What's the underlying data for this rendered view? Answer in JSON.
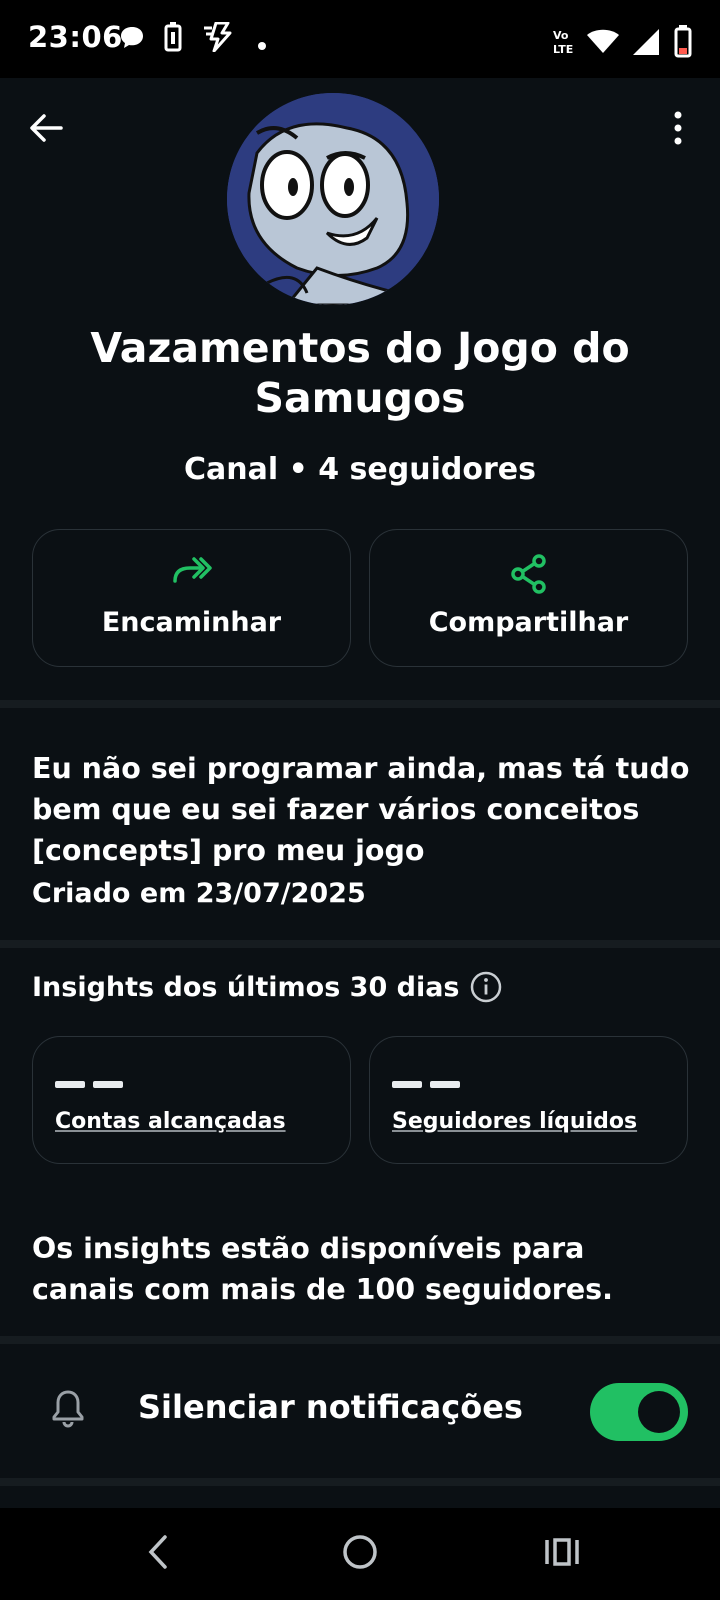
{
  "status_bar": {
    "time": "23:06",
    "left_icons": [
      "chat-bubble-icon",
      "battery-saver-icon",
      "flash-icon",
      "dot-icon"
    ],
    "right_icons": [
      "volte-icon",
      "wifi-icon",
      "signal-icon",
      "battery-icon"
    ],
    "volte_text": "Vo LTE"
  },
  "header": {
    "back_icon": "arrow-left-icon",
    "menu_icon": "more-vertical-icon"
  },
  "channel": {
    "name": "Vazamentos do Jogo do Samugos",
    "subtitle": "Canal • 4 seguidores",
    "description": "Eu não sei programar ainda, mas tá tudo bem que eu sei fazer vários conceitos [concepts] pro meu jogo",
    "created": "Criado em 23/07/2025"
  },
  "actions": [
    {
      "label": "Encaminhar",
      "icon": "forward-icon"
    },
    {
      "label": "Compartilhar",
      "icon": "share-icon"
    }
  ],
  "insights": {
    "heading": "Insights dos últimos 30 dias",
    "info_icon": "info-icon",
    "cards": [
      {
        "value": "— —",
        "label": "Contas alcançadas"
      },
      {
        "value": "— —",
        "label": "Seguidores líquidos"
      }
    ],
    "note": "Os insights estão disponíveis para canais com mais de 100 seguidores."
  },
  "mute": {
    "label": "Silenciar notificações",
    "icon": "bell-icon",
    "enabled": true
  },
  "colors": {
    "accent": "#21c063",
    "background": "#0b1014",
    "card_border": "#2a3238"
  },
  "nav_bar": [
    "back-nav-icon",
    "home-nav-icon",
    "recents-nav-icon"
  ]
}
